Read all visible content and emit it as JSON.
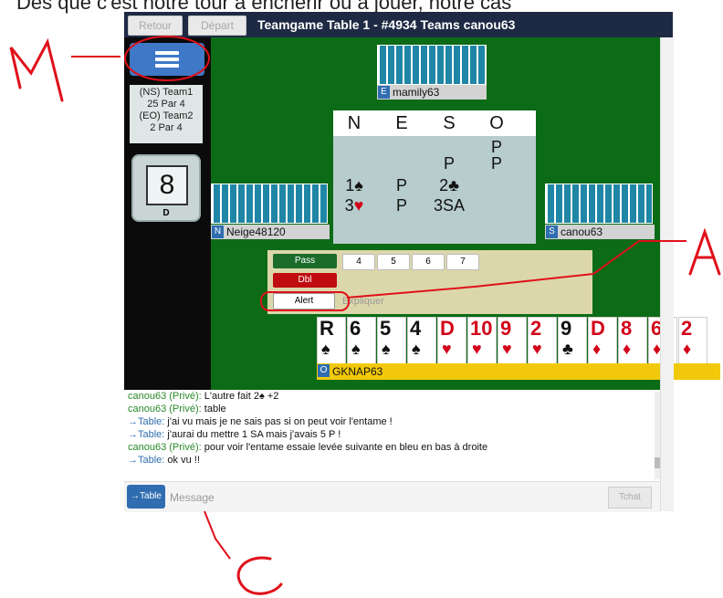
{
  "caption": "Dès que c'est notre tour à enchérir ou à jouer, notre cas",
  "topbar": {
    "back_label": "Retour",
    "depart_label": "Départ",
    "title": "Teamgame Table 1 - #4934 Teams canou63"
  },
  "sidebar": {
    "menu_icon": "hamburger-menu-icon",
    "score_ns": "(NS) Team1",
    "score_ns_val": "25 Par 4",
    "score_eo": "(EO) Team2",
    "score_eo_val": "2 Par 4",
    "board_number": "8",
    "dealer": "D"
  },
  "players": {
    "east": {
      "seat": "E",
      "name": "mamily63"
    },
    "north": {
      "seat": "N",
      "name": "Neige48120"
    },
    "south": {
      "seat": "S",
      "name": "canou63"
    },
    "west": {
      "seat": "O",
      "name": "GKNAP63"
    }
  },
  "bidding": {
    "headers": [
      "N",
      "E",
      "S",
      "O"
    ],
    "row1": {
      "O": "P"
    },
    "row2": {
      "S": "P",
      "O": "P"
    },
    "row3": {
      "N": "1♠",
      "E": "P",
      "S": "2♣"
    },
    "row4": {
      "N": "3",
      "N_suit": "♥",
      "E": "P",
      "S": "3SA"
    }
  },
  "panel": {
    "pass_label": "Pass",
    "dbl_label": "Dbl",
    "alert_label": "Alert",
    "explain_placeholder": "Expliquer",
    "levels": [
      "4",
      "5",
      "6",
      "7"
    ]
  },
  "hand": [
    {
      "rank": "R",
      "suit": "♠",
      "color": "black"
    },
    {
      "rank": "6",
      "suit": "♠",
      "color": "black"
    },
    {
      "rank": "5",
      "suit": "♠",
      "color": "black"
    },
    {
      "rank": "4",
      "suit": "♠",
      "color": "black"
    },
    {
      "rank": "D",
      "suit": "♥",
      "color": "red"
    },
    {
      "rank": "10",
      "suit": "♥",
      "color": "red"
    },
    {
      "rank": "9",
      "suit": "♥",
      "color": "red"
    },
    {
      "rank": "2",
      "suit": "♥",
      "color": "red"
    },
    {
      "rank": "9",
      "suit": "♣",
      "color": "black"
    },
    {
      "rank": "D",
      "suit": "♦",
      "color": "red"
    },
    {
      "rank": "8",
      "suit": "♦",
      "color": "red"
    },
    {
      "rank": "6",
      "suit": "♦",
      "color": "red"
    },
    {
      "rank": "2",
      "suit": "♦",
      "color": "red"
    }
  ],
  "chat": {
    "lines": [
      {
        "who": "canou63 (Privé):",
        "type": "priv",
        "text": " L'autre fait 2♠ +2"
      },
      {
        "who": "canou63 (Privé):",
        "type": "priv",
        "text": " table"
      },
      {
        "who": "→Table:",
        "type": "tbl",
        "text": " j'ai vu mais je ne sais pas si on peut voir l'entame !"
      },
      {
        "who": "→Table:",
        "type": "tbl",
        "text": " j'aurai du mettre 1 SA mais j'avais 5 P !"
      },
      {
        "who": "canou63 (Privé):",
        "type": "priv",
        "text": " pour voir l'entame essaie levée suivante en bleu en bas à droite"
      },
      {
        "who": "→Table:",
        "type": "tbl",
        "text": " ok vu !!"
      }
    ],
    "target_label": "→Table",
    "message_placeholder": "Message",
    "send_label": "Tchat"
  },
  "annotations": {
    "m": "M",
    "a": "A",
    "c": "C"
  },
  "colors": {
    "felt": "#0c6b16",
    "annotation": "#e0101a",
    "accent": "#2f6db0"
  }
}
